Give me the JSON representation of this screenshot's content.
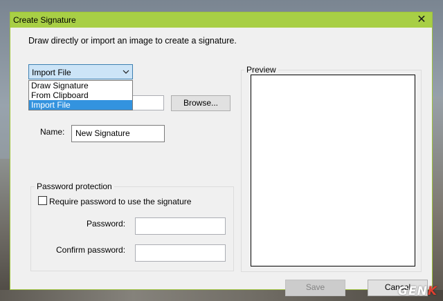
{
  "dialog": {
    "title": "Create Signature",
    "close_glyph": "✕",
    "instruction": "Draw directly or import an image to create a signature.",
    "source_combo": {
      "selected": "Import File",
      "options": [
        "Draw Signature",
        "From Clipboard",
        "Import File"
      ],
      "highlighted_index": 2
    },
    "browse_label": "Browse...",
    "name_label": "Name:",
    "name_value": "New Signature",
    "password_group": {
      "title": "Password protection",
      "require_label": "Require password to use the signature",
      "require_checked": false,
      "password_label": "Password:",
      "confirm_label": "Confirm password:"
    },
    "preview_title": "Preview",
    "save_label": "Save",
    "save_enabled": false,
    "cancel_label": "Cancel"
  },
  "watermark": {
    "text_main": "GEN",
    "text_accent": "K"
  },
  "colors": {
    "titlebar": "#a8cf45",
    "highlight": "#3393df",
    "combo_bg": "#cce4f7",
    "combo_border": "#3c7fb1"
  }
}
